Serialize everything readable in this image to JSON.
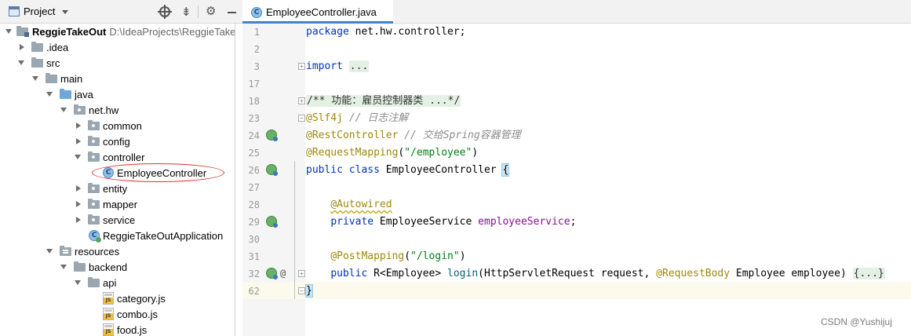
{
  "project_panel": {
    "title": "Project",
    "tree": [
      {
        "label": "ReggieTakeOut",
        "path": "D:\\IdeaProjects\\ReggieTakeOut",
        "bold": true,
        "icon": "module-folder-icon"
      },
      {
        "label": ".idea",
        "icon": "folder-icon"
      },
      {
        "label": "src",
        "icon": "folder-icon"
      },
      {
        "label": "main",
        "icon": "folder-icon"
      },
      {
        "label": "java",
        "icon": "source-folder-icon"
      },
      {
        "label": "net.hw",
        "icon": "package-icon"
      },
      {
        "label": "common",
        "icon": "package-icon"
      },
      {
        "label": "config",
        "icon": "package-icon"
      },
      {
        "label": "controller",
        "icon": "package-icon"
      },
      {
        "label": "EmployeeController",
        "icon": "java-class-icon",
        "icon_letter": "C"
      },
      {
        "label": "entity",
        "icon": "package-icon"
      },
      {
        "label": "mapper",
        "icon": "package-icon"
      },
      {
        "label": "service",
        "icon": "package-icon"
      },
      {
        "label": "ReggieTakeOutApplication",
        "icon": "spring-app-class-icon",
        "icon_letter": "C"
      },
      {
        "label": "resources",
        "icon": "resources-folder-icon"
      },
      {
        "label": "backend",
        "icon": "folder-icon"
      },
      {
        "label": "api",
        "icon": "folder-icon"
      },
      {
        "label": "category.js",
        "icon": "js-file-icon"
      },
      {
        "label": "combo.js",
        "icon": "js-file-icon"
      },
      {
        "label": "food.js",
        "icon": "js-file-icon"
      }
    ]
  },
  "editor": {
    "active_tab": "EmployeeController.java",
    "tab_icon_letter": "C",
    "line_numbers": [
      "1",
      "2",
      "3",
      "17",
      "18",
      "23",
      "24",
      "25",
      "26",
      "27",
      "28",
      "29",
      "30",
      "31",
      "32",
      "62"
    ],
    "code": {
      "l1_kw": "package",
      "l1_rest": " net.hw.controller;",
      "l3_kw": "import",
      "l3_fold": "...",
      "l18_doc": "/** 功能：雇员控制器类 ...*/",
      "l23_ann": "@Slf4j",
      "l23_cmt": " // 日志注解",
      "l24_ann": "@RestController",
      "l24_cmt": " // 交给Spring容器管理",
      "l25_ann": "@RequestMapping",
      "l25_open": "(",
      "l25_str": "\"/employee\"",
      "l25_close": ")",
      "l26_kw": "public class",
      "l26_name": " EmployeeController ",
      "l26_brace": "{",
      "l28_ann": "@Autowired",
      "l29_kw": "private",
      "l29_type": " EmployeeService ",
      "l29_field": "employeeService",
      "l29_end": ";",
      "l31_ann": "@PostMapping",
      "l31_open": "(",
      "l31_str": "\"/login\"",
      "l31_close": ")",
      "l32_kw": "public",
      "l32_ret": " R<Employee> ",
      "l32_fn": "login",
      "l32_params1": "(HttpServletRequest request, ",
      "l32_ann": "@RequestBody",
      "l32_params2": " Employee employee) ",
      "l32_fold": "{...}",
      "l62_brace": "}"
    },
    "gutter_at_symbol": "@"
  },
  "watermark": "CSDN @Yushijuj",
  "colors": {
    "keyword": "#0033b3",
    "annotation": "#9e880d",
    "string": "#067d17",
    "comment": "#8c8c8c",
    "field": "#871094",
    "highlight_ellipse": "#e03030"
  }
}
